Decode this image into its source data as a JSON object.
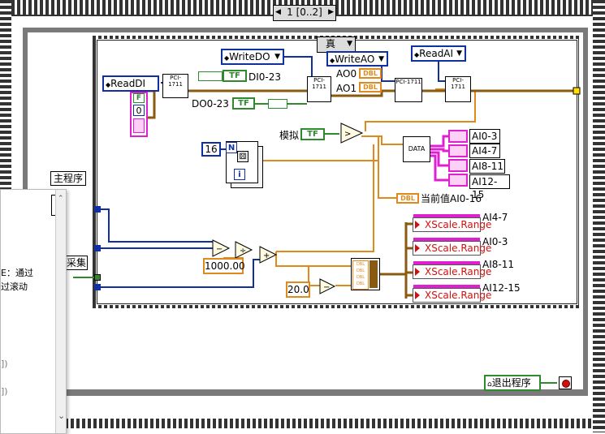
{
  "case_selector": {
    "label": "1 [0..2]",
    "left_arrow": "◀",
    "right_arrow": "▶"
  },
  "inner_case": {
    "label": "真"
  },
  "controls": {
    "read_di": "ReadDI",
    "write_do": "WriteDO",
    "write_ao": "WriteAO",
    "read_ai": "ReadAI"
  },
  "vi_label": "PCI-1711",
  "labels": {
    "di": "DI0-23",
    "do": "DO0-23",
    "ao0": "AO0",
    "ao1": "AO1",
    "simulate": "模拟",
    "current_ai": "当前值AI0-16",
    "data": "DATA",
    "ai0_3": "AI0-3",
    "ai4_7": "AI4-7",
    "ai8_11": "AI8-11",
    "ai12_15": "AI12-15",
    "main_program": "主程序",
    "acquire": "采集",
    "exit_program": "退出程序"
  },
  "constants": {
    "tf": "TF",
    "dbl": "DBL",
    "f": "F",
    "zero": "0",
    "n": "N",
    "i": "i",
    "sixteen": "16",
    "thousand": "1000.00",
    "twenty": "20.0"
  },
  "xscale_items": [
    {
      "label": "XScale.Range",
      "target": "AI4-7"
    },
    {
      "label": "XScale.Range",
      "target": "AI0-3"
    },
    {
      "label": "XScale.Range",
      "target": "AI8-11"
    },
    {
      "label": "XScale.Range",
      "target": "AI12-15"
    }
  ],
  "side_panel": {
    "text1": "E：通过",
    "text2": "过滚动",
    "bracket1": "])",
    "bracket2": "])",
    "scroll_down": "⌄",
    "bracket_open": "}"
  },
  "colors": {
    "wire_orange": "#e08a1e",
    "wire_blue": "#1030a0",
    "wire_green": "#2f8a2f",
    "wire_pink": "#e020d0",
    "wire_brown": "#8a5a10"
  }
}
